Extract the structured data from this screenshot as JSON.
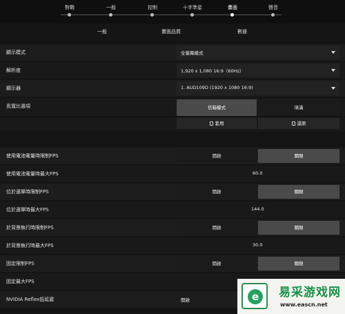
{
  "top_tabs": [
    {
      "label": "對戰",
      "active": false
    },
    {
      "label": "一般",
      "active": false
    },
    {
      "label": "控制",
      "active": false
    },
    {
      "label": "十字準星",
      "active": false
    },
    {
      "label": "畫面",
      "active": true
    },
    {
      "label": "聲音",
      "active": false
    }
  ],
  "sub_tabs": [
    {
      "label": "一般"
    },
    {
      "label": "畫面品質"
    },
    {
      "label": "數據"
    }
  ],
  "settings": {
    "display_mode": {
      "label": "顯示模式",
      "value": "全螢幕模式"
    },
    "resolution": {
      "label": "解析度",
      "value": "1,920 x 1,080 16:9（60Hz）"
    },
    "monitor": {
      "label": "顯示器",
      "value": "1. AUD109D (1920 x 1080 16:9)"
    },
    "aspect_ratio": {
      "label": "長寬比選項",
      "option_a": "信箱模式",
      "option_b": "填滿",
      "apply": "套用",
      "restore": "還原"
    },
    "battery_limit_fps": {
      "label": "使用電池電量時限制FPS",
      "on": "開啟",
      "off": "關閉",
      "selected": "off"
    },
    "battery_max_fps": {
      "label": "使用電池電量時最大FPS",
      "value": "60.0"
    },
    "menu_limit_fps": {
      "label": "位於選單時限制FPS",
      "on": "開啟",
      "off": "關閉",
      "selected": "off"
    },
    "menu_max_fps": {
      "label": "位於選單時最大FPS",
      "value": "144.0"
    },
    "background_limit_fps": {
      "label": "於背景執行時限制FPS",
      "on": "開啟",
      "off": "關閉",
      "selected": "off"
    },
    "background_max_fps": {
      "label": "於背景執行時最大FPS",
      "value": "30.0"
    },
    "fixed_limit_fps": {
      "label": "固定限制FPS",
      "on": "開啟",
      "off": "關閉",
      "selected": "off"
    },
    "fixed_max_fps": {
      "label": "固定最大FPS",
      "value": ""
    },
    "reflex": {
      "label": "NVIDIA Reflex低延遲",
      "value": "開啟"
    }
  },
  "watermark": {
    "title": "易采游戏网",
    "url": "www.eascn.net"
  }
}
